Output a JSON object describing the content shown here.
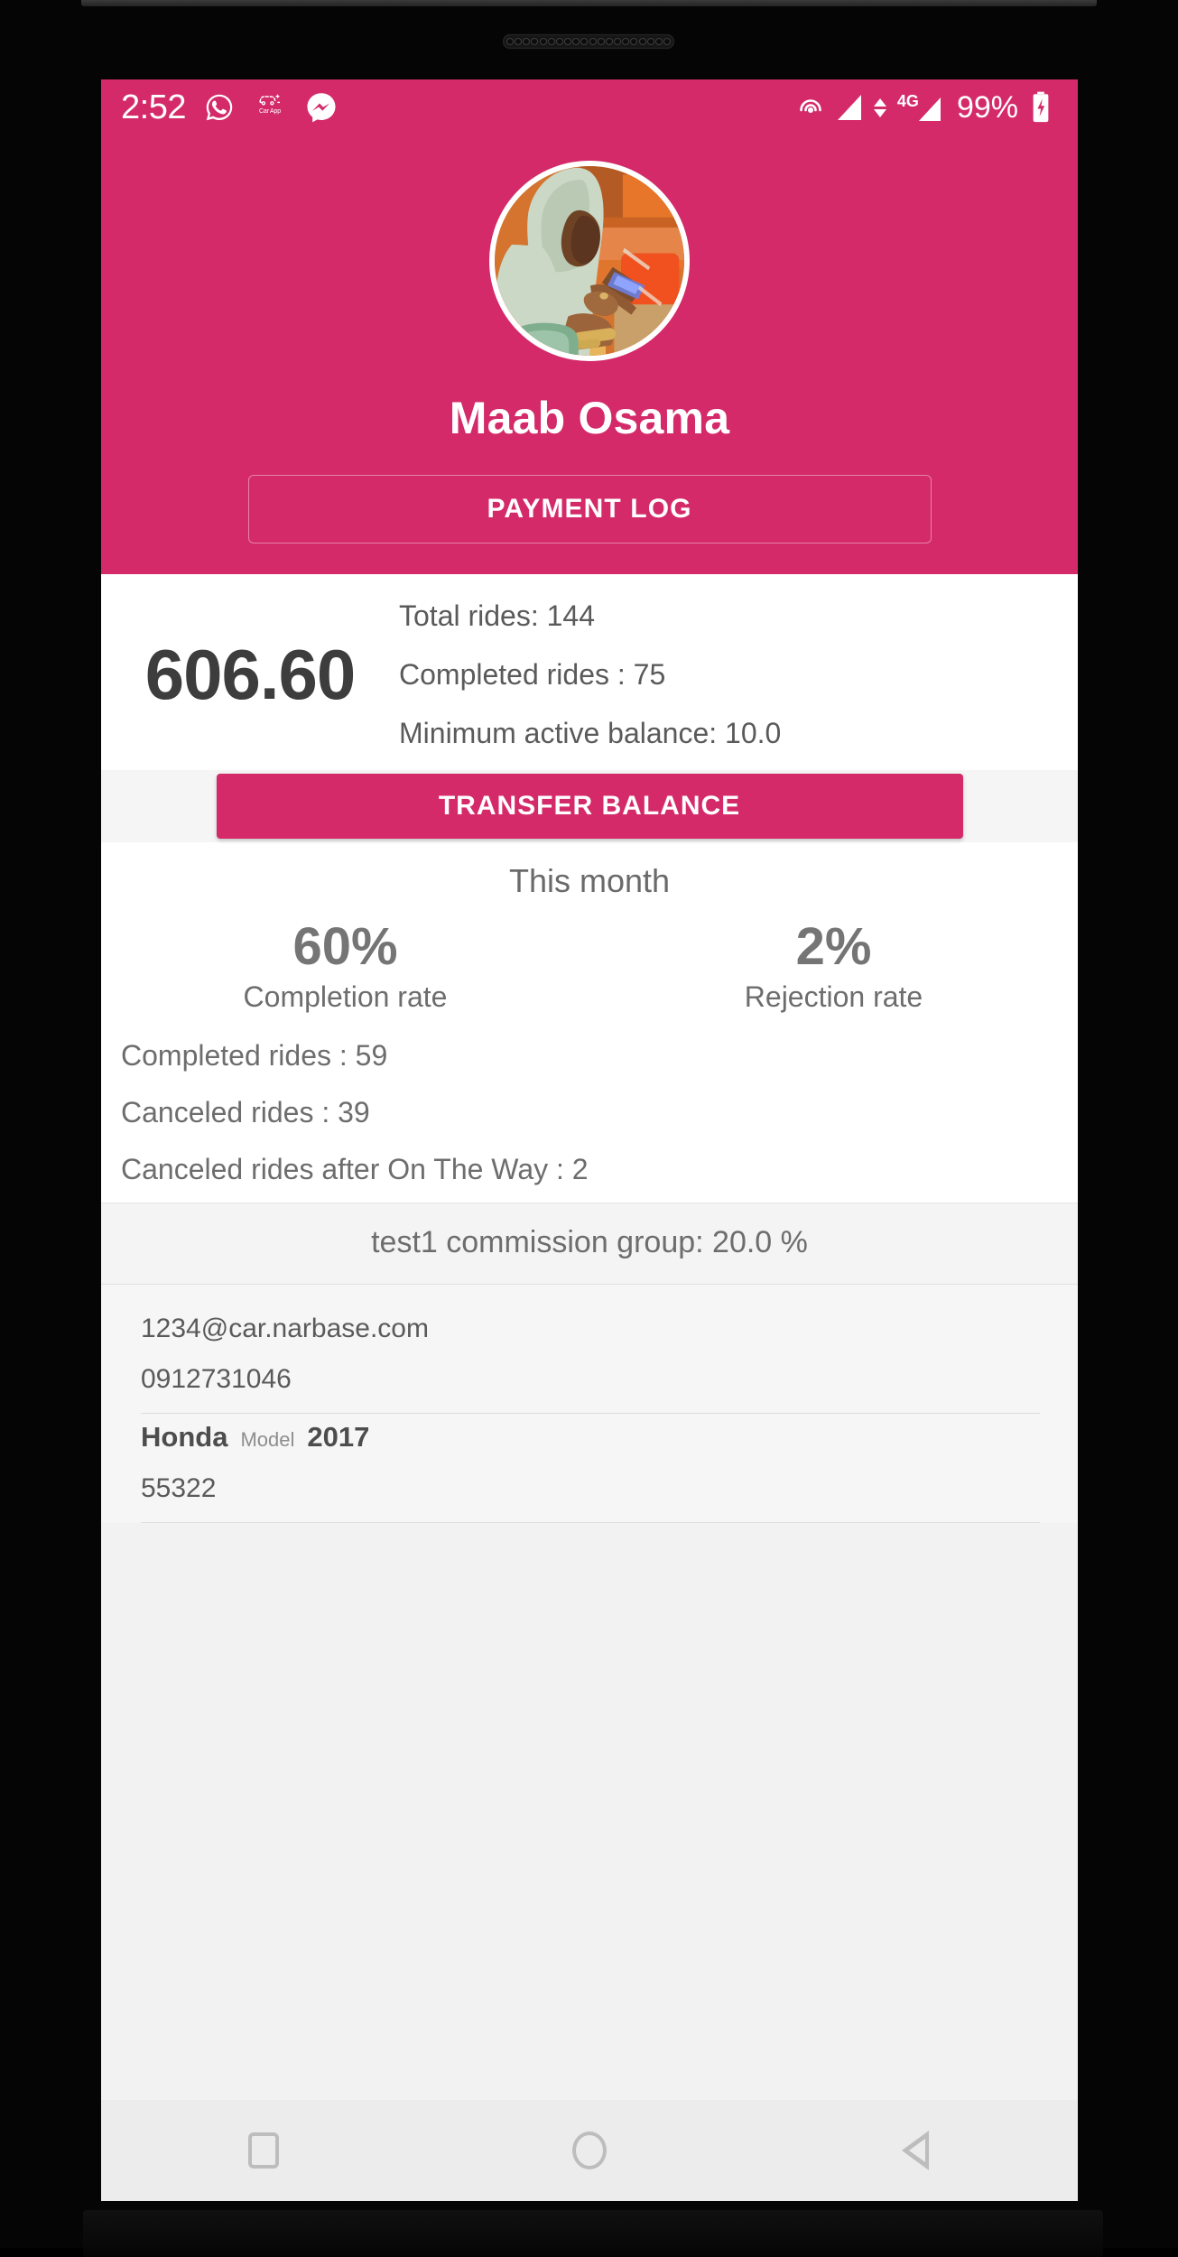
{
  "status_bar": {
    "clock": "2:52",
    "battery_percent": "99%",
    "network_type": "4G",
    "icons": [
      "whatsapp-icon",
      "car-app-icon",
      "messenger-icon",
      "hotspot-icon",
      "signal-icon",
      "data-transfer-icon",
      "signal-icon-2",
      "battery-charging-icon"
    ],
    "car_app_label": "Car App"
  },
  "profile": {
    "name": "Maab Osama",
    "payment_log_label": "PAYMENT LOG",
    "avatar_alt": "driver-profile-photo"
  },
  "balance": {
    "amount": "606.60",
    "stats": [
      "Total rides: 144",
      "Completed rides : 75",
      "Minimum active balance: 10.0"
    ],
    "transfer_label": "TRANSFER BALANCE"
  },
  "month": {
    "title": "This month",
    "rates": [
      {
        "value": "60%",
        "label": "Completion rate"
      },
      {
        "value": "2%",
        "label": "Rejection rate"
      }
    ],
    "stats": [
      "Completed rides : 59",
      "Canceled rides : 39",
      "Canceled rides after On The Way : 2"
    ]
  },
  "commission": {
    "text": "test1 commission group: 20.0 %"
  },
  "details": {
    "email": "1234@car.narbase.com",
    "phone": "0912731046",
    "vehicle_make": "Honda",
    "vehicle_model_label": "Model",
    "vehicle_year": "2017",
    "plate_number": "55322"
  },
  "nav_bar": {
    "recents": "recents-icon",
    "home": "home-icon",
    "back": "back-icon"
  },
  "colors": {
    "brand_pink": "#d42a69",
    "text_gray": "#6d6d6d",
    "bg_light": "#f6f6f6"
  }
}
